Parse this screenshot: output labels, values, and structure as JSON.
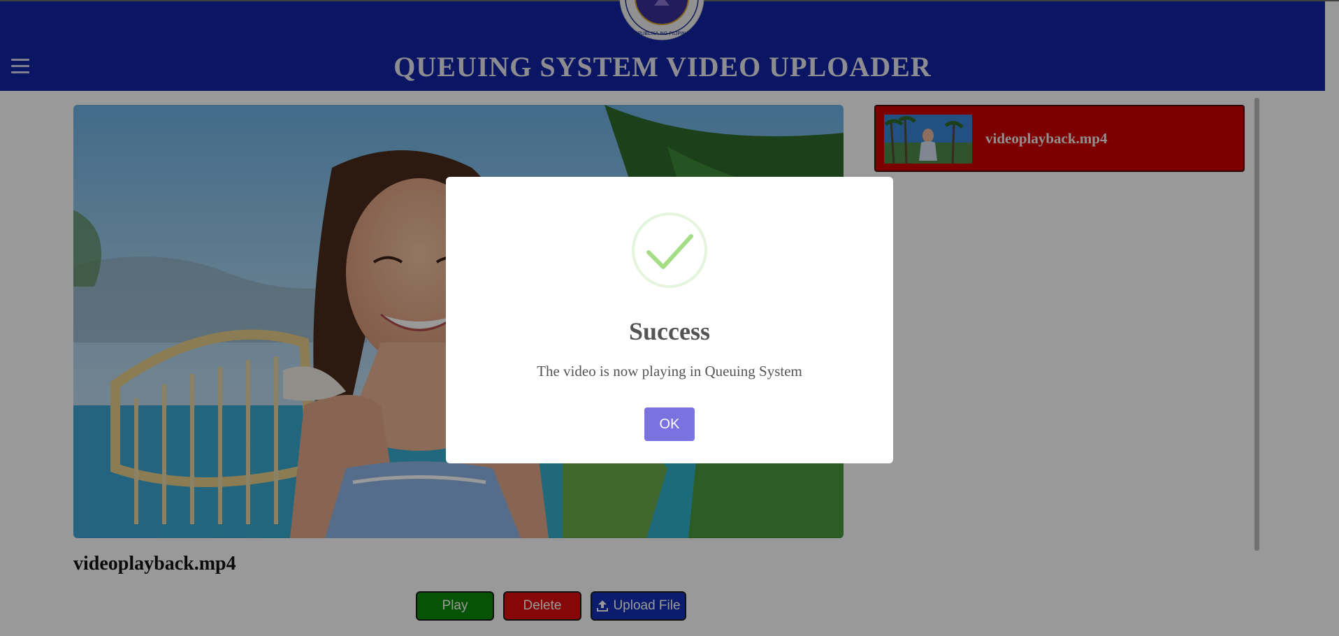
{
  "header": {
    "title": "QUEUING SYSTEM VIDEO UPLOADER",
    "seal_text": "REPUBLIKA NG PILIPINAS",
    "menu_icon": "hamburger-menu-icon"
  },
  "player": {
    "current_file": "videoplayback.mp4"
  },
  "controls": {
    "play_label": "Play",
    "delete_label": "Delete",
    "upload_label": "Upload File",
    "upload_icon": "upload-icon"
  },
  "playlist": {
    "items": [
      {
        "label": "videoplayback.mp4"
      }
    ]
  },
  "dialog": {
    "icon": "success-check-icon",
    "title": "Success",
    "message": "The video is now playing in Queuing System",
    "ok_label": "OK"
  },
  "colors": {
    "header_bg": "#1126a6",
    "playlist_item_bg": "#cf0000",
    "play_button": "#0a8a0a",
    "delete_button": "#e00d0d",
    "upload_button": "#1330b8",
    "ok_button": "#7b72e2",
    "success_green": "#a5dc86"
  }
}
